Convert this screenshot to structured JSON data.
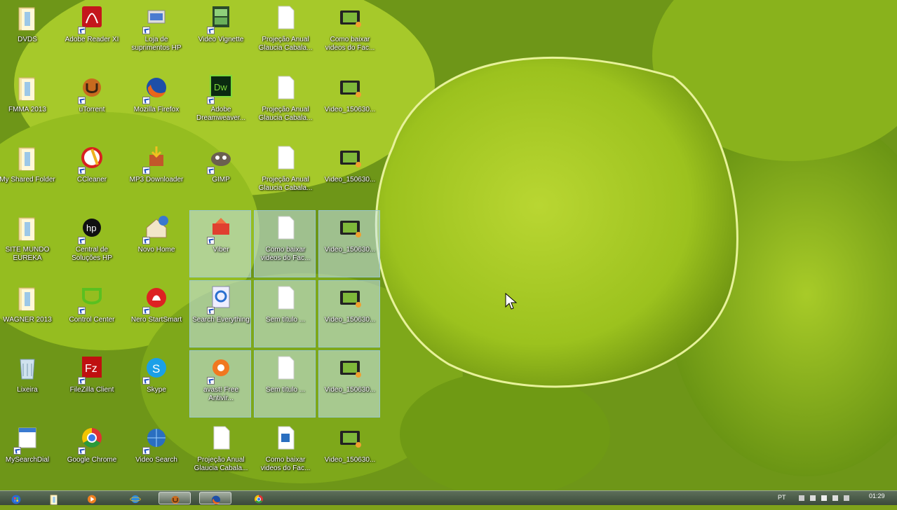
{
  "desktop": {
    "icons": [
      {
        "label": "DVDS",
        "icon": "folder-icon",
        "shortcut": false,
        "selected": false
      },
      {
        "label": "Adobe Reader XI",
        "icon": "adobe-reader-icon",
        "shortcut": true,
        "selected": false
      },
      {
        "label": "Loja de suprimentos HP",
        "icon": "hp-store-icon",
        "shortcut": true,
        "selected": false
      },
      {
        "label": "Video Vignette",
        "icon": "video-app-icon",
        "shortcut": true,
        "selected": false
      },
      {
        "label": "Projeção Anual Glaucia Cabala...",
        "icon": "document-icon",
        "shortcut": false,
        "selected": false
      },
      {
        "label": "Como baixar videos do Fac...",
        "icon": "video-file-icon",
        "shortcut": false,
        "selected": false
      },
      {
        "label": "FMMA 2013",
        "icon": "folder-icon",
        "shortcut": false,
        "selected": false
      },
      {
        "label": "uTorrent",
        "icon": "utorrent-icon",
        "shortcut": true,
        "selected": false
      },
      {
        "label": "Mozilla Firefox",
        "icon": "firefox-icon",
        "shortcut": true,
        "selected": false
      },
      {
        "label": "Adobe Dreamweaver...",
        "icon": "dreamweaver-icon",
        "shortcut": true,
        "selected": false
      },
      {
        "label": "Projeção Anual Glaucia Cabala...",
        "icon": "document-icon",
        "shortcut": false,
        "selected": false
      },
      {
        "label": "Video_150630...",
        "icon": "video-file-icon",
        "shortcut": false,
        "selected": false
      },
      {
        "label": "My Shared Folder",
        "icon": "folder-icon",
        "shortcut": false,
        "selected": false
      },
      {
        "label": "CCleaner",
        "icon": "ccleaner-icon",
        "shortcut": true,
        "selected": false
      },
      {
        "label": "MP3 Downloader",
        "icon": "downloader-icon",
        "shortcut": true,
        "selected": false
      },
      {
        "label": "GIMP",
        "icon": "gimp-icon",
        "shortcut": true,
        "selected": false
      },
      {
        "label": "Projeção Anual Glaucia Cabala...",
        "icon": "document-icon",
        "shortcut": false,
        "selected": false
      },
      {
        "label": "Video_150630...",
        "icon": "video-file-icon",
        "shortcut": false,
        "selected": false
      },
      {
        "label": "SITE MUNDO EUREKA",
        "icon": "folder-icon",
        "shortcut": false,
        "selected": false
      },
      {
        "label": "Central de Soluções HP",
        "icon": "hp-icon",
        "shortcut": true,
        "selected": false
      },
      {
        "label": "Novo Home",
        "icon": "home-icon",
        "shortcut": true,
        "selected": false
      },
      {
        "label": "Viber",
        "icon": "app-box-icon",
        "shortcut": true,
        "selected": true
      },
      {
        "label": "Como baixar videos do Fac...",
        "icon": "document-icon",
        "shortcut": false,
        "selected": true
      },
      {
        "label": "Video_150630...",
        "icon": "video-file-icon",
        "shortcut": false,
        "selected": true
      },
      {
        "label": "WAGNER 2013",
        "icon": "folder-icon",
        "shortcut": false,
        "selected": false
      },
      {
        "label": "Control Center",
        "icon": "control-center-icon",
        "shortcut": true,
        "selected": false
      },
      {
        "label": "Nero StartSmart",
        "icon": "nero-icon",
        "shortcut": true,
        "selected": false
      },
      {
        "label": "Search Everything",
        "icon": "search-app-icon",
        "shortcut": true,
        "selected": true
      },
      {
        "label": "Sem título ...",
        "icon": "document-icon",
        "shortcut": false,
        "selected": true
      },
      {
        "label": "Video_150630...",
        "icon": "video-file-icon",
        "shortcut": false,
        "selected": true
      },
      {
        "label": "Lixeira",
        "icon": "recycle-bin-icon",
        "shortcut": false,
        "selected": false
      },
      {
        "label": "FileZilla Client",
        "icon": "filezilla-icon",
        "shortcut": true,
        "selected": false
      },
      {
        "label": "Skype",
        "icon": "skype-icon",
        "shortcut": true,
        "selected": false
      },
      {
        "label": "avast! Free Antivir...",
        "icon": "avast-icon",
        "shortcut": true,
        "selected": true
      },
      {
        "label": "Sem título ...",
        "icon": "document-icon",
        "shortcut": false,
        "selected": true
      },
      {
        "label": "Video_150630...",
        "icon": "video-file-icon",
        "shortcut": false,
        "selected": true
      },
      {
        "label": "MySearchDial",
        "icon": "calendar-app-icon",
        "shortcut": true,
        "selected": false
      },
      {
        "label": "Google Chrome",
        "icon": "chrome-icon",
        "shortcut": true,
        "selected": false
      },
      {
        "label": "Video Search",
        "icon": "globe-search-icon",
        "shortcut": true,
        "selected": false
      },
      {
        "label": "Projeção Anual Glaucia Cabala...",
        "icon": "document-icon",
        "shortcut": false,
        "selected": false
      },
      {
        "label": "Como baixar videos do Fac...",
        "icon": "word-doc-icon",
        "shortcut": false,
        "selected": false
      },
      {
        "label": "Video_150630...",
        "icon": "video-file-icon",
        "shortcut": false,
        "selected": false
      }
    ]
  },
  "taskbar": {
    "buttons": [
      {
        "name": "start-button",
        "icon": "windows-orb-icon",
        "active": false
      },
      {
        "name": "taskbar-explorer",
        "icon": "folder-icon",
        "active": false
      },
      {
        "name": "taskbar-media-player",
        "icon": "media-player-icon",
        "active": false
      },
      {
        "name": "taskbar-internet-explorer",
        "icon": "ie-icon",
        "active": false
      },
      {
        "name": "taskbar-utorrent",
        "icon": "utorrent-icon",
        "active": true
      },
      {
        "name": "taskbar-firefox",
        "icon": "firefox-icon",
        "active": true
      },
      {
        "name": "taskbar-chrome",
        "icon": "chrome-icon",
        "active": false
      }
    ],
    "tray": {
      "language": "PT",
      "time": "01:29"
    }
  },
  "colors": {
    "wallpaper_light": "#c7e03a",
    "wallpaper_dark": "#4f7a10",
    "selection": "#c8e4f0"
  }
}
